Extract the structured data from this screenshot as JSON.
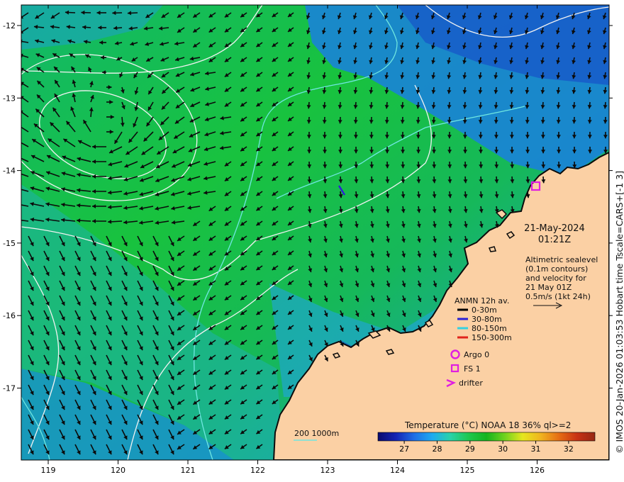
{
  "colors": {
    "land": "#fbd0a4",
    "coast": "#0b0b0b",
    "contour": "#f2f2f2",
    "isobath": "#6fe6e0",
    "arrow": "#0b0b0b",
    "frame": "#000000",
    "argo": "#e01ee0",
    "fs": "#e01ee0",
    "drifter": "#e01ee0"
  },
  "axes": {
    "x_ticks": [
      "119",
      "120",
      "121",
      "122",
      "123",
      "124",
      "125",
      "126"
    ],
    "y_ticks": [
      "-12",
      "-13",
      "-14",
      "-15",
      "-16",
      "-17"
    ]
  },
  "date": {
    "line1": "21-May-2024",
    "line2": "01:21Z"
  },
  "altimetry_note": [
    "Altimetric sealevel",
    "(0.1m contours)",
    "and velocity for",
    "21 May 01Z",
    "0.5m/s (1kt 24h)"
  ],
  "anmn": {
    "title": "ANMN 12h av.",
    "items": [
      {
        "label": "0-30m",
        "color": "#000000"
      },
      {
        "label": "30-80m",
        "color": "#2b22d6"
      },
      {
        "label": "80-150m",
        "color": "#36d1e0"
      },
      {
        "label": "150-300m",
        "color": "#e0241b"
      }
    ]
  },
  "markers": {
    "argo_label": "Argo 0",
    "fs_label": "FS 1",
    "drifter_label": "drifter"
  },
  "scale": {
    "label": "200  1000m"
  },
  "colorbar": {
    "title": "Temperature (°C) NOAA 18 36% ql>=2",
    "ticks": [
      "27",
      "28",
      "29",
      "30",
      "31",
      "32"
    ],
    "range": [
      26.2,
      32.8
    ],
    "stops": [
      "#0a0a6e",
      "#1424b4",
      "#1e6ee6",
      "#1eaaf0",
      "#28d2aa",
      "#1ec850",
      "#14b41e",
      "#6ed21e",
      "#e6e61e",
      "#f0b41e",
      "#e66e14",
      "#c83214",
      "#962814"
    ]
  },
  "side_caption": "© IMOS 20-Jan-2026 01:03:53 Hobart time Tscale=CARS+[-1 3]"
}
